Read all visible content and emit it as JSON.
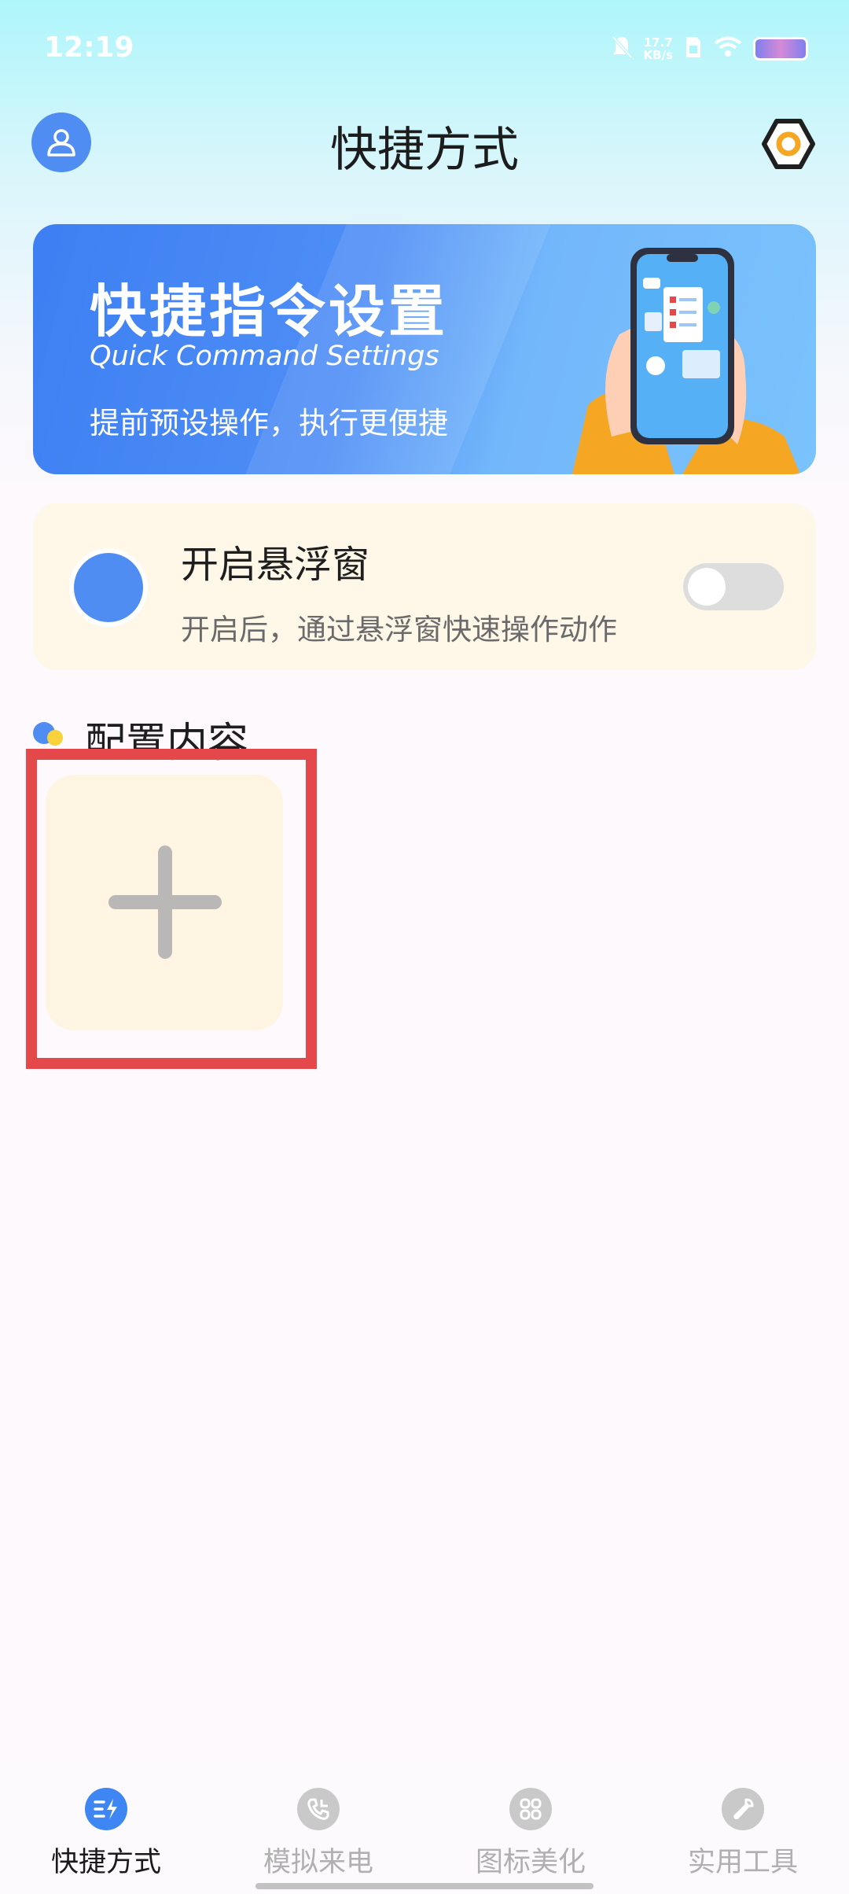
{
  "status_bar": {
    "time": "12:19",
    "net_speed_value": "17.7",
    "net_speed_unit": "KB/s"
  },
  "header": {
    "title": "快捷方式"
  },
  "banner": {
    "title": "快捷指令设置",
    "subtitle": "Quick Command Settings",
    "description": "提前预设操作，执行更便捷"
  },
  "floating_window": {
    "title": "开启悬浮窗",
    "description": "开启后，通过悬浮窗快速操作动作",
    "enabled": false
  },
  "config": {
    "title": "配置内容"
  },
  "bottom_nav": {
    "items": [
      {
        "label": "快捷方式",
        "icon": "shortcut-icon",
        "active": true
      },
      {
        "label": "模拟来电",
        "icon": "phone-call-icon",
        "active": false
      },
      {
        "label": "图标美化",
        "icon": "grid-icon",
        "active": false
      },
      {
        "label": "实用工具",
        "icon": "wrench-icon",
        "active": false
      }
    ]
  },
  "colors": {
    "accent": "#4f8df3",
    "highlight": "#e5484a",
    "card_background": "#fff7e8"
  }
}
